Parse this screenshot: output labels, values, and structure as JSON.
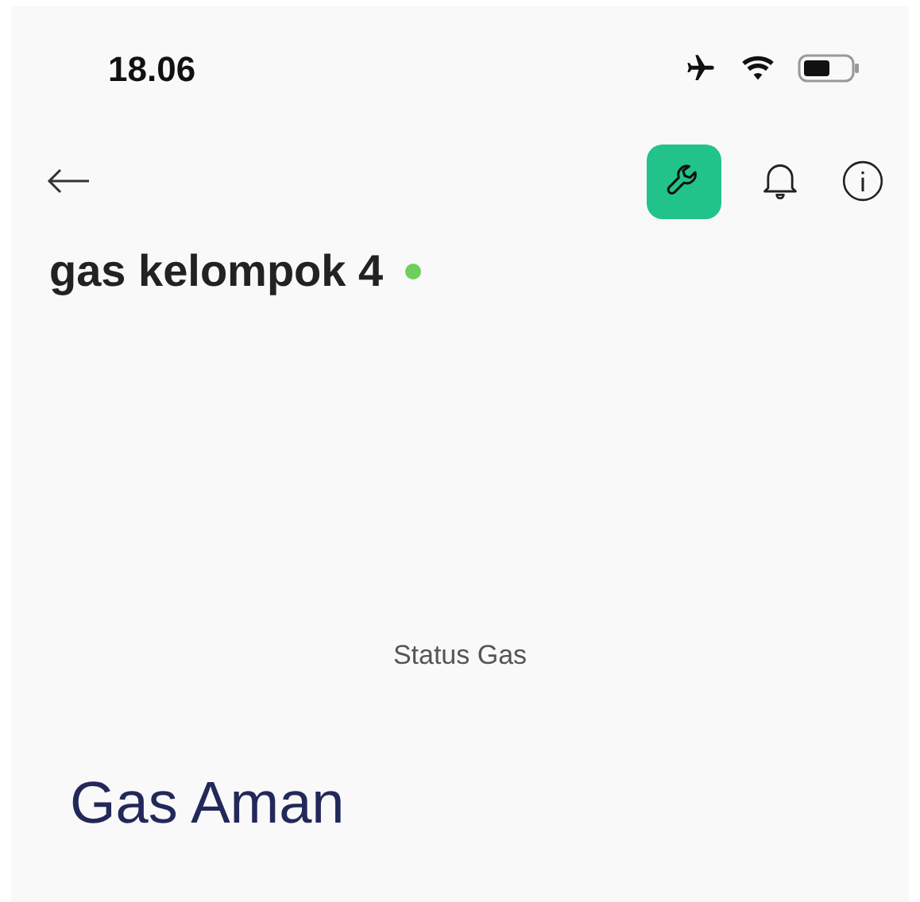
{
  "status_bar": {
    "time": "18.06"
  },
  "toolbar": {
    "actions": [
      {
        "kind": "settings",
        "selected": true
      },
      {
        "kind": "notifications",
        "selected": false
      },
      {
        "kind": "info",
        "selected": false
      }
    ]
  },
  "device": {
    "name": "gas kelompok 4",
    "online": true
  },
  "widget": {
    "label": "Status Gas",
    "value": "Gas Aman"
  }
}
